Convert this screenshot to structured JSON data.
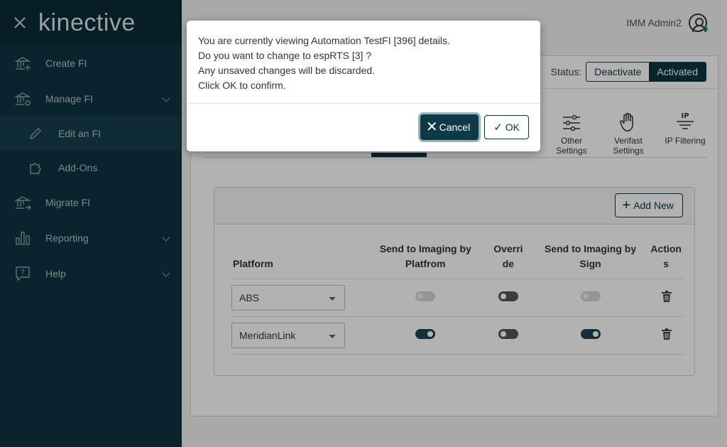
{
  "sidebar": {
    "logo": "kinective",
    "items": [
      {
        "label": "Create FI",
        "icon": "bank-plus-icon"
      },
      {
        "label": "Manage FI",
        "icon": "bank-gear-icon"
      },
      {
        "label": "Edit an FI",
        "icon": "pencil-icon"
      },
      {
        "label": "Add-Ons",
        "icon": "puzzle-icon"
      },
      {
        "label": "Migrate FI",
        "icon": "bank-arrow-icon"
      },
      {
        "label": "Reporting",
        "icon": "bar-chart-icon"
      },
      {
        "label": "Help",
        "icon": "help-bubble-icon"
      }
    ]
  },
  "header": {
    "user": "IMM Admin2"
  },
  "status": {
    "label": "Status:",
    "deactivate": "Deactivate",
    "activated": "Activated"
  },
  "tools": [
    {
      "label1": "Other",
      "label2": "Settings",
      "icon": "sliders-icon"
    },
    {
      "label1": "Verifast",
      "label2": "Settings",
      "icon": "hand-icon"
    },
    {
      "label1": "IP Filtering",
      "label2": "",
      "icon": "ip-filter-icon"
    }
  ],
  "panel": {
    "add_new": "Add New",
    "columns": {
      "platform": "Platform",
      "send_platform_1": "Send to Imaging by",
      "send_platform_2": "Platfrom",
      "override_1": "Overri",
      "override_2": "de",
      "send_sign": "Send to Imaging by Sign",
      "actions_1": "Action",
      "actions_2": "s"
    },
    "rows": [
      {
        "platform": "ABS",
        "send_platform": false,
        "override": false,
        "send_sign": false,
        "disabled": true
      },
      {
        "platform": "MeridianLink",
        "send_platform": true,
        "override": false,
        "send_sign": true,
        "disabled": false
      }
    ]
  },
  "modal": {
    "line1": "You are currently viewing Automation TestFI [396] details.",
    "line2": "Do you want to change to espRTS [3] ?",
    "line3": "Any unsaved changes will be discarded.",
    "line4": "Click OK to confirm.",
    "cancel": "Cancel",
    "ok": "OK"
  }
}
